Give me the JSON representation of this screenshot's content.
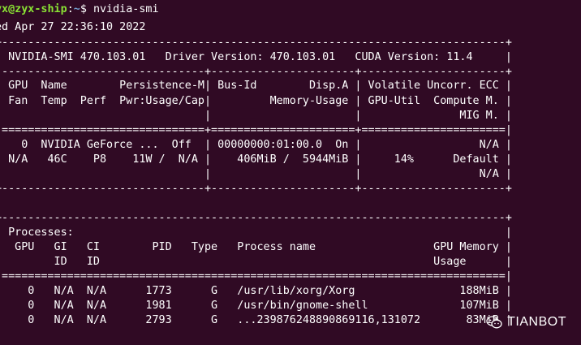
{
  "prompt": {
    "user_host": "yx@zyx-ship",
    "separator": ":",
    "path": "~",
    "symbol": "$ ",
    "command": "nvidia-smi"
  },
  "lines": [
    "ed Apr 27 22:36:10 2022",
    "+-----------------------------------------------------------------------------+",
    "| NVIDIA-SMI 470.103.01   Driver Version: 470.103.01   CUDA Version: 11.4     |",
    "|-------------------------------+----------------------+----------------------+",
    "| GPU  Name        Persistence-M| Bus-Id        Disp.A | Volatile Uncorr. ECC |",
    "| Fan  Temp  Perf  Pwr:Usage/Cap|         Memory-Usage | GPU-Util  Compute M. |",
    "|                               |                      |               MIG M. |",
    "|===============================+======================+======================|",
    "|   0  NVIDIA GeForce ...  Off  | 00000000:01:00.0  On |                  N/A |",
    "| N/A   46C    P8    11W /  N/A |    406MiB /  5944MiB |     14%      Default |",
    "|                               |                      |                  N/A |",
    "+-------------------------------+----------------------+----------------------+",
    "",
    "+-----------------------------------------------------------------------------+",
    "| Processes:                                                                  |",
    "|  GPU   GI   CI        PID   Type   Process name                  GPU Memory |",
    "|        ID   ID                                                   Usage      |",
    "|=============================================================================|",
    "|    0   N/A  N/A      1773      G   /usr/lib/xorg/Xorg                188MiB |",
    "|    0   N/A  N/A      1981      G   /usr/bin/gnome-shell              107MiB |",
    "|    0   N/A  N/A      2793      G   ...239876248890869116,131072       83MiB |"
  ],
  "watermark": {
    "icon": "wechat-icon",
    "text": "TIANBOT"
  },
  "colors": {
    "background": "#300a24",
    "text": "#ffffff",
    "user_host": "#8ae234",
    "path": "#729fcf"
  }
}
